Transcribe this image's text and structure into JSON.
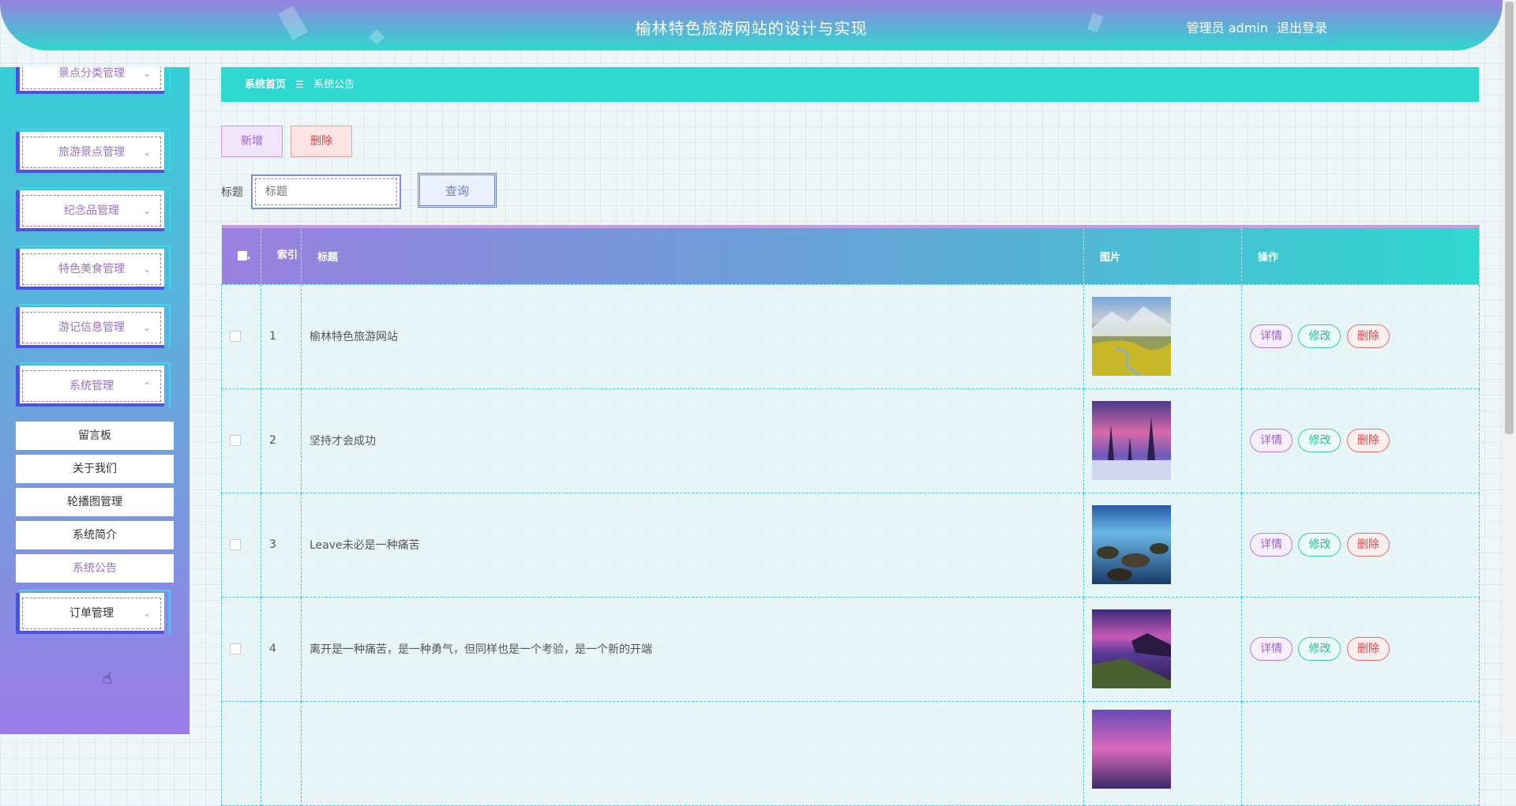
{
  "header": {
    "title": "榆林特色旅游网站的设计与实现",
    "user_label": "管理员 admin",
    "logout_label": "退出登录"
  },
  "sidebar": {
    "partial_top_label": "景点分类管理",
    "menus": [
      {
        "label": "旅游景点管理",
        "chevron": "⌄"
      },
      {
        "label": "纪念品管理",
        "chevron": "⌄"
      },
      {
        "label": "特色美食管理",
        "chevron": "⌄"
      },
      {
        "label": "游记信息管理",
        "chevron": "⌄"
      },
      {
        "label": "系统管理",
        "chevron": "⌃"
      }
    ],
    "submenu": [
      {
        "label": "留言板"
      },
      {
        "label": "关于我们"
      },
      {
        "label": "轮播图管理"
      },
      {
        "label": "系统简介"
      },
      {
        "label": "系统公告"
      }
    ],
    "bottom_menu": {
      "label": "订单管理",
      "chevron": "⌄"
    }
  },
  "breadcrumb": {
    "home": "系统首页",
    "separator": "☰",
    "current": "系统公告"
  },
  "toolbar": {
    "add_label": "新增",
    "delete_label": "删除"
  },
  "search": {
    "label": "标题",
    "placeholder": "标题",
    "query_label": "查询"
  },
  "table": {
    "columns": {
      "index": "索引",
      "title": "标题",
      "image": "图片",
      "actions": "操作"
    },
    "actions": {
      "detail": "详情",
      "edit": "修改",
      "delete": "删除"
    },
    "rows": [
      {
        "index": "1",
        "title": "榆林特色旅游网站",
        "image": "meadow-mountain-photo"
      },
      {
        "index": "2",
        "title": "坚持才会成功",
        "image": "snowy-forest-sunset-photo"
      },
      {
        "index": "3",
        "title": "Leave未必是一种痛苦",
        "image": "blue-rocky-coast-photo"
      },
      {
        "index": "4",
        "title": "离开是一种痛苦，是一种勇气，但同样也是一个考验，是一个新的开端",
        "image": "purple-coast-photo"
      }
    ]
  },
  "colors": {
    "header_top": "#9a80e0",
    "header_bottom": "#2ed8cf",
    "breadcrumb_bg": "#2ed8cf",
    "accent_purple": "#9a60d0",
    "accent_teal": "#2eb89e",
    "accent_red": "#d04a4a"
  }
}
